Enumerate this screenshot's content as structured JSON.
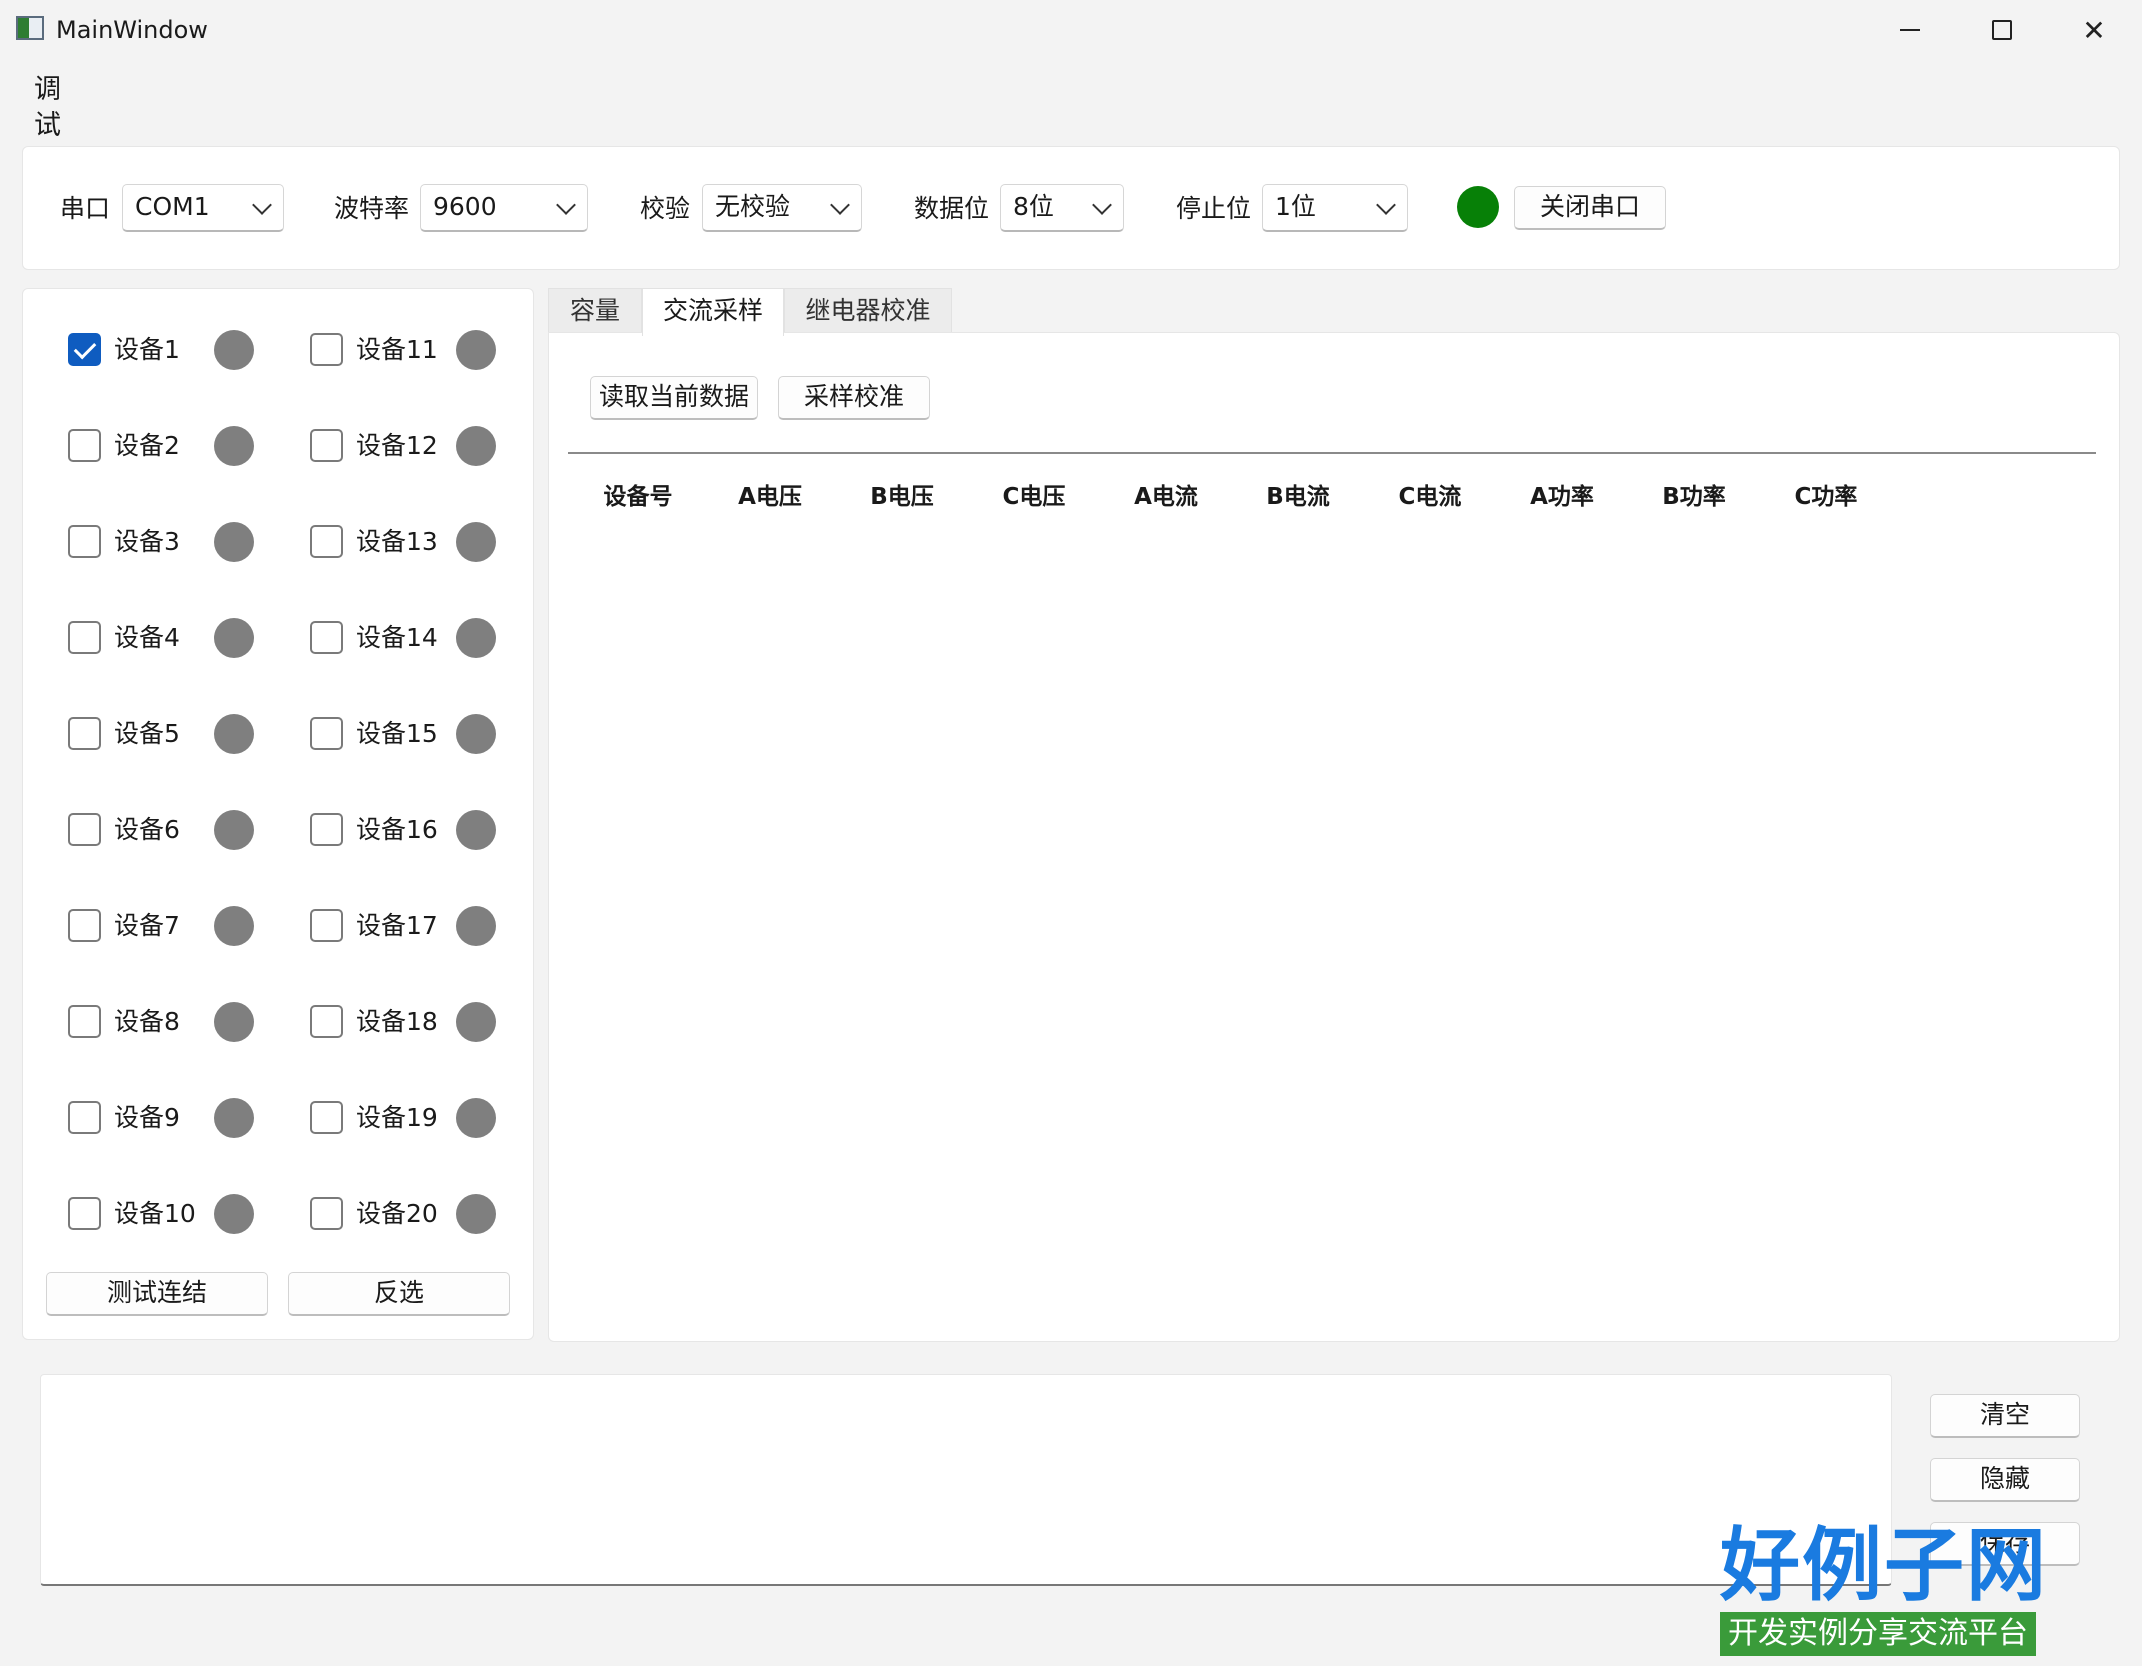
{
  "window": {
    "title": "MainWindow"
  },
  "menu": {
    "debug": "调试"
  },
  "serial": {
    "port_label": "串口",
    "port_value": "COM1",
    "baud_label": "波特率",
    "baud_value": "9600",
    "parity_label": "校验",
    "parity_value": "无校验",
    "databits_label": "数据位",
    "databits_value": "8位",
    "stopbits_label": "停止位",
    "stopbits_value": "1位",
    "status_color": "#078007",
    "close_label": "关闭串口"
  },
  "devices": [
    {
      "label": "设备1",
      "checked": true
    },
    {
      "label": "设备2",
      "checked": false
    },
    {
      "label": "设备3",
      "checked": false
    },
    {
      "label": "设备4",
      "checked": false
    },
    {
      "label": "设备5",
      "checked": false
    },
    {
      "label": "设备6",
      "checked": false
    },
    {
      "label": "设备7",
      "checked": false
    },
    {
      "label": "设备8",
      "checked": false
    },
    {
      "label": "设备9",
      "checked": false
    },
    {
      "label": "设备10",
      "checked": false
    },
    {
      "label": "设备11",
      "checked": false
    },
    {
      "label": "设备12",
      "checked": false
    },
    {
      "label": "设备13",
      "checked": false
    },
    {
      "label": "设备14",
      "checked": false
    },
    {
      "label": "设备15",
      "checked": false
    },
    {
      "label": "设备16",
      "checked": false
    },
    {
      "label": "设备17",
      "checked": false
    },
    {
      "label": "设备18",
      "checked": false
    },
    {
      "label": "设备19",
      "checked": false
    },
    {
      "label": "设备20",
      "checked": false
    }
  ],
  "device_actions": {
    "test": "测试连结",
    "invert": "反选"
  },
  "tabs": [
    {
      "label": "容量",
      "active": false
    },
    {
      "label": "交流采样",
      "active": true
    },
    {
      "label": "继电器校准",
      "active": false
    }
  ],
  "sampling": {
    "read_label": "读取当前数据",
    "calibrate_label": "采样校准",
    "columns": [
      "设备号",
      "A电压",
      "B电压",
      "C电压",
      "A电流",
      "B电流",
      "C电流",
      "A功率",
      "B功率",
      "C功率"
    ]
  },
  "log_actions": {
    "clear": "清空",
    "hide": "隐藏",
    "save": "保存"
  },
  "watermark": {
    "brand": "好例子网",
    "tagline": "开发实例分享交流平台"
  }
}
